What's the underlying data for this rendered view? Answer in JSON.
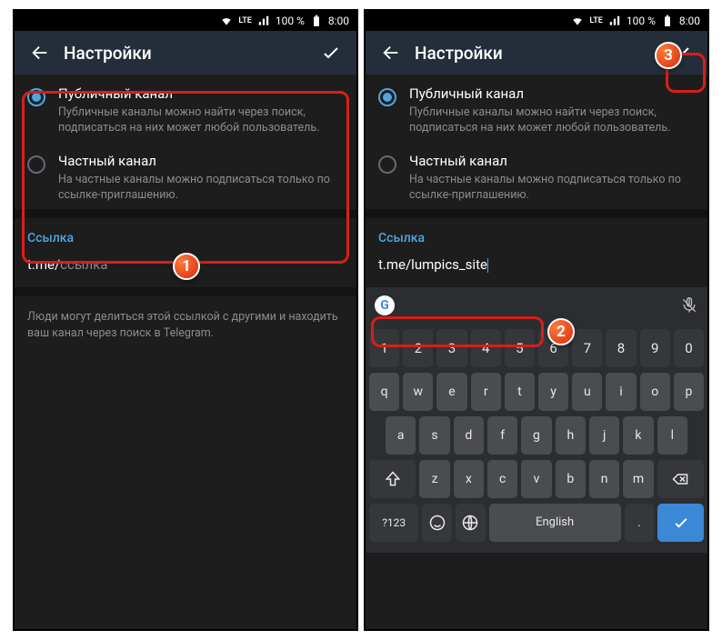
{
  "status": {
    "lte": "LTE",
    "battery": "100 %",
    "time": "8:00"
  },
  "header": {
    "title": "Настройки"
  },
  "options": {
    "public": {
      "label": "Публичный канал",
      "desc": "Публичные каналы можно найти через поиск, подписаться на них может любой пользователь."
    },
    "private": {
      "label": "Частный канал",
      "desc": "На частные каналы можно подписаться только по ссылке-приглашению."
    }
  },
  "link": {
    "section": "Ссылка",
    "prefix": "t.me/",
    "placeholder": "ссылка",
    "value": "lumpics_site",
    "hint": "Люди могут делиться этой ссылкой с другими и находить ваш канал через поиск в Telegram."
  },
  "keyboard": {
    "row_nums": [
      "1",
      "2",
      "3",
      "4",
      "5",
      "6",
      "7",
      "8",
      "9",
      "0"
    ],
    "row1": [
      "q",
      "w",
      "e",
      "r",
      "t",
      "y",
      "u",
      "i",
      "o",
      "p"
    ],
    "row2": [
      "a",
      "s",
      "d",
      "f",
      "g",
      "h",
      "j",
      "k",
      "l"
    ],
    "row3": [
      "z",
      "x",
      "c",
      "v",
      "b",
      "n",
      "m"
    ],
    "mode": "?123",
    "space": "English",
    "dot": "."
  },
  "badges": {
    "b1": "1",
    "b2": "2",
    "b3": "3"
  }
}
